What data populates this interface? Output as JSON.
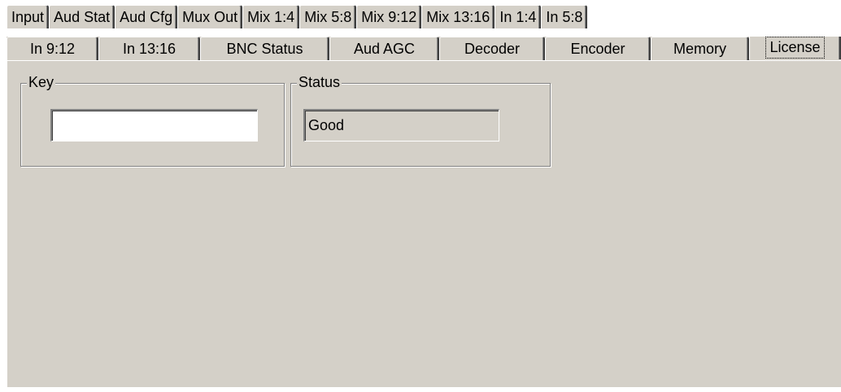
{
  "tabs_row1": [
    {
      "label": "Input"
    },
    {
      "label": "Aud Stat"
    },
    {
      "label": "Aud Cfg"
    },
    {
      "label": "Mux Out"
    },
    {
      "label": "Mix 1:4"
    },
    {
      "label": "Mix 5:8"
    },
    {
      "label": "Mix 9:12"
    },
    {
      "label": "Mix 13:16"
    },
    {
      "label": "In 1:4"
    },
    {
      "label": "In 5:8"
    }
  ],
  "tabs_row2": [
    {
      "label": "In 9:12"
    },
    {
      "label": "In 13:16"
    },
    {
      "label": "BNC Status"
    },
    {
      "label": "Aud AGC"
    },
    {
      "label": "Decoder"
    },
    {
      "label": "Encoder"
    },
    {
      "label": "Memory"
    },
    {
      "label": "License"
    }
  ],
  "active_tab": "License",
  "key_group": {
    "title": "Key",
    "input_value": ""
  },
  "status_group": {
    "title": "Status",
    "value": "Good"
  },
  "colors": {
    "face": "#d4d0c8",
    "shadow": "#808080",
    "highlight": "#ffffff",
    "dark_shadow": "#404040"
  }
}
